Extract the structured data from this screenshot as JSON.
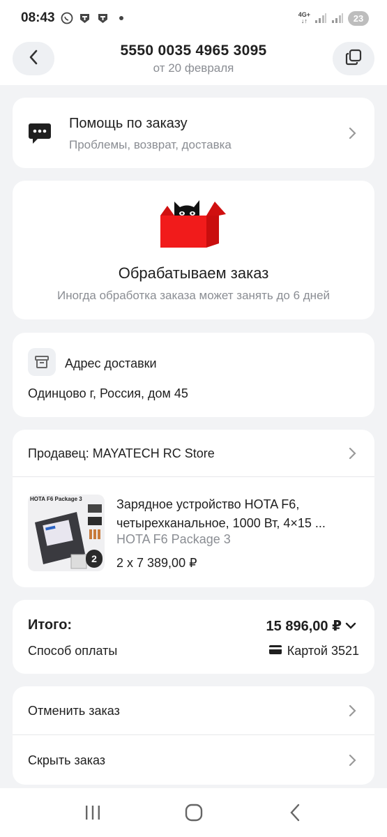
{
  "status_bar": {
    "time": "08:43",
    "network": "4G+",
    "battery": "23"
  },
  "header": {
    "title": "5550 0035 4965 3095",
    "subtitle": "от 20 февраля"
  },
  "help": {
    "title": "Помощь по заказу",
    "subtitle": "Проблемы, возврат, доставка"
  },
  "order_status": {
    "title": "Обрабатываем заказ",
    "subtitle": "Иногда обработка заказа может занять до 6 дней"
  },
  "address": {
    "title": "Адрес доставки",
    "value": "Одинцово г, Россия, дом 45"
  },
  "seller": {
    "label": "Продавец: MAYATECH RC Store",
    "product": {
      "thumb_label": "HOTA F6 Package 3",
      "name": "Зарядное устройство HOTA F6, четырехканальное, 1000 Вт, 4×15 ...",
      "variant": "HOTA F6 Package 3",
      "price": "2 x 7 389,00 ₽",
      "quantity_badge": "2"
    }
  },
  "totals": {
    "label": "Итого:",
    "value": "15 896,00 ₽",
    "payment_label": "Способ оплаты",
    "payment_value": "Картой 3521"
  },
  "actions": {
    "cancel": "Отменить заказ",
    "hide": "Скрыть заказ"
  },
  "icons": {
    "back": "chevron-left-icon",
    "copy": "copy-icon",
    "help": "chat-bubble-icon",
    "status": "cat-box-illustration",
    "address": "archive-box-icon",
    "card": "credit-card-icon"
  },
  "colors": {
    "accent_red": "#f11b1b",
    "text_primary": "#1f1f1f",
    "text_secondary": "#8a8d93",
    "background": "#f2f3f5"
  }
}
